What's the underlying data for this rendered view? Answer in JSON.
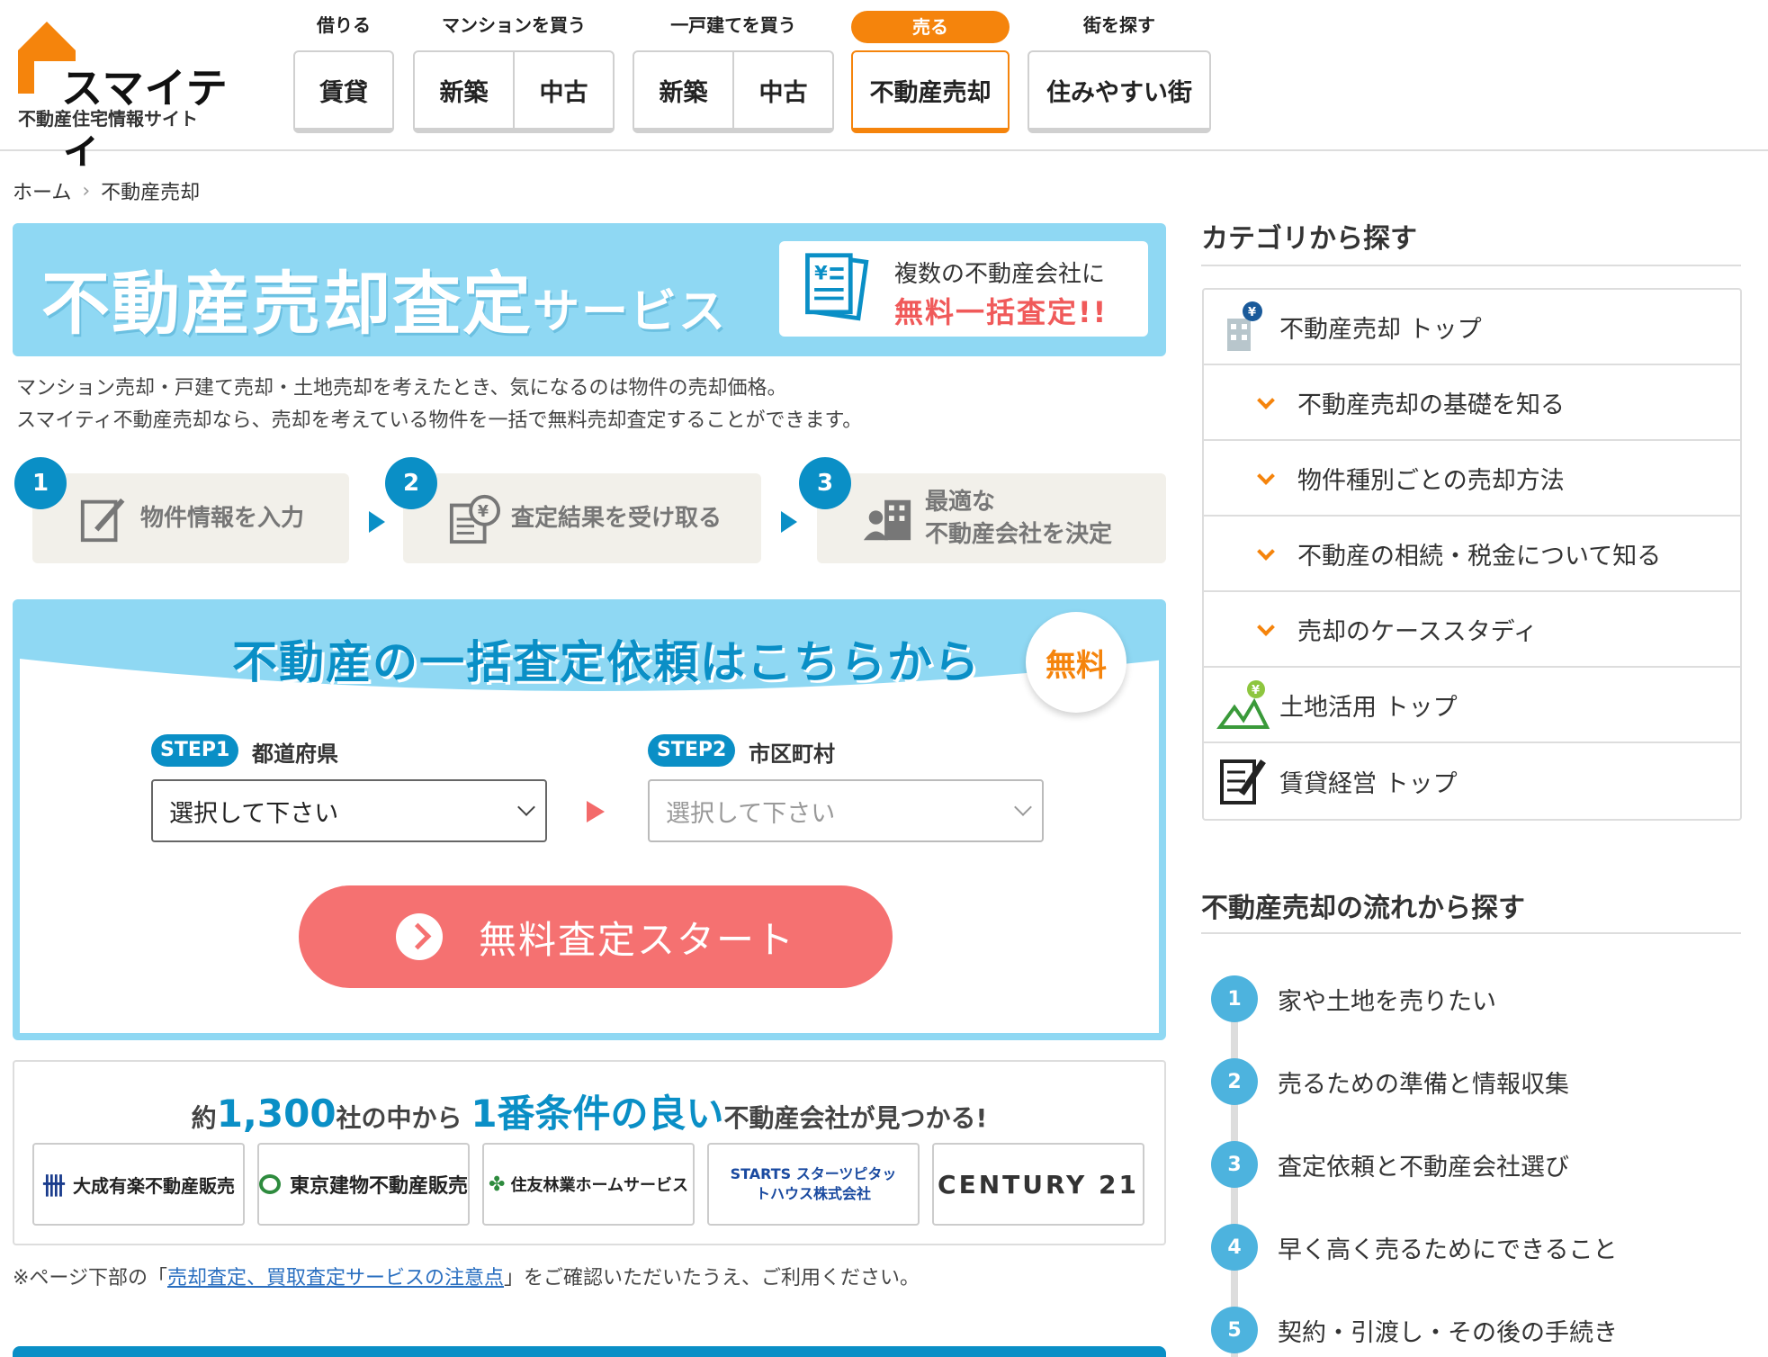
{
  "logo": {
    "name": "スマイティ",
    "tagline": "不動産住宅情報サイト"
  },
  "nav": [
    {
      "category": "借りる",
      "items": [
        "賃貸"
      ]
    },
    {
      "category": "マンションを買う",
      "items": [
        "新築",
        "中古"
      ]
    },
    {
      "category": "一戸建てを買う",
      "items": [
        "新築",
        "中古"
      ]
    },
    {
      "category": "売る",
      "items": [
        "不動産売却"
      ],
      "active": true
    },
    {
      "category": "街を探す",
      "items": [
        "住みやすい街"
      ]
    }
  ],
  "breadcrumb": {
    "home": "ホーム",
    "current": "不動産売却"
  },
  "hero": {
    "title": "不動産売却査定",
    "title_small": "サービス",
    "box_line1": "複数の不動産会社に",
    "box_line2": "無料一括査定!!"
  },
  "intro": {
    "line1": "マンション売却・戸建て売却・土地売却を考えたとき、気になるのは物件の売却価格。",
    "line2": "スマイティ不動産売却なら、売却を考えている物件を一括で無料売却査定することができます。"
  },
  "steps": [
    {
      "num": "1",
      "label": "物件情報を入力"
    },
    {
      "num": "2",
      "label": "査定結果を受け取る"
    },
    {
      "num": "3",
      "label_line1": "最適な",
      "label_line2": "不動産会社を決定"
    }
  ],
  "form": {
    "title": "不動産の一括査定依頼はこちらから",
    "badge": "無料",
    "step1_pill": "STEP1",
    "step1_label": "都道府県",
    "step1_value": "選択して下さい",
    "step2_pill": "STEP2",
    "step2_label": "市区町村",
    "step2_value": "選択して下さい",
    "cta": "無料査定スタート"
  },
  "companies": {
    "headline_pre": "約",
    "headline_num": "1,300",
    "headline_mid": "社の中から",
    "headline_hl": "1番条件の良い",
    "headline_post": "不動産会社が見つかる!",
    "logos": [
      "大成有楽不動産販売",
      "東京建物不動産販売",
      "住友林業ホームサービス",
      "STARTS スターツピタットハウス株式会社",
      "CENTURY 21"
    ]
  },
  "note": {
    "pre": "※ページ下部の「",
    "link": "売却査定、買取査定サービスの注意点",
    "post": "」をご確認いただいたうえ、ご利用ください。"
  },
  "sidebar": {
    "category_heading": "カテゴリから探す",
    "categories": [
      {
        "label": "不動産売却 トップ",
        "icon": "building-yen-icon"
      },
      {
        "label": "不動産売却の基礎を知る",
        "sub": true
      },
      {
        "label": "物件種別ごとの売却方法",
        "sub": true
      },
      {
        "label": "不動産の相続・税金について知る",
        "sub": true
      },
      {
        "label": "売却のケーススタディ",
        "sub": true
      },
      {
        "label": "土地活用 トップ",
        "icon": "land-yen-icon"
      },
      {
        "label": "賃貸経営 トップ",
        "icon": "document-pen-icon"
      }
    ],
    "flow_heading": "不動産売却の流れから探す",
    "flow": [
      {
        "num": "1",
        "label": "家や土地を売りたい"
      },
      {
        "num": "2",
        "label": "売るための準備と情報収集"
      },
      {
        "num": "3",
        "label": "査定依頼と不動産会社選び"
      },
      {
        "num": "4",
        "label": "早く高く売るためにできること"
      },
      {
        "num": "5",
        "label": "契約・引渡し・その後の手続き"
      }
    ]
  },
  "colors": {
    "accent_orange": "#f5840c",
    "accent_blue": "#0a8fc6",
    "light_blue": "#8fd8f3",
    "cta_red": "#f57171"
  }
}
